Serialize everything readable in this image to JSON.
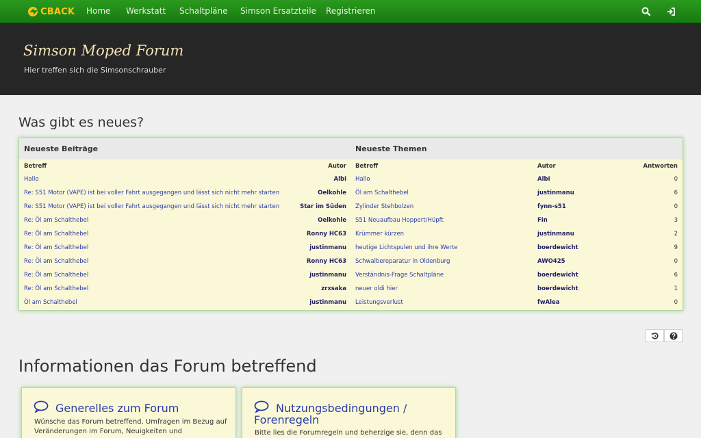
{
  "nav": {
    "brand": "CBACK",
    "items": [
      "Home",
      "Werkstatt",
      "Schaltpläne",
      "Simson Ersatzteile",
      "Registrieren"
    ]
  },
  "header": {
    "title": "Simson Moped Forum",
    "subtitle": "Hier treffen sich die Simsonschrauber"
  },
  "news": {
    "heading": "Was gibt es neues?",
    "posts": {
      "title": "Neueste Beiträge",
      "col_subject": "Betreff",
      "col_author": "Autor",
      "rows": [
        {
          "subject": "Hallo",
          "author": "Albi"
        },
        {
          "subject": "Re: S51 Motor (VAPE) ist bei voller Fahrt ausgegangen und lässt sich nicht mehr starten",
          "author": "Oelkohle"
        },
        {
          "subject": "Re: S51 Motor (VAPE) ist bei voller Fahrt ausgegangen und lässt sich nicht mehr starten",
          "author": "Star im Süden"
        },
        {
          "subject": "Re: Öl am Schalthebel",
          "author": "Oelkohle"
        },
        {
          "subject": "Re: Öl am Schalthebel",
          "author": "Ronny HC63"
        },
        {
          "subject": "Re: Öl am Schalthebel",
          "author": "justinmanu"
        },
        {
          "subject": "Re: Öl am Schalthebel",
          "author": "Ronny HC63"
        },
        {
          "subject": "Re: Öl am Schalthebel",
          "author": "justinmanu"
        },
        {
          "subject": "Re: Öl am Schalthebel",
          "author": "zrxsaka"
        },
        {
          "subject": "Öl am Schalthebel",
          "author": "justinmanu"
        }
      ]
    },
    "topics": {
      "title": "Neueste Themen",
      "col_subject": "Betreff",
      "col_author": "Autor",
      "col_replies": "Antworten",
      "rows": [
        {
          "subject": "Hallo",
          "author": "Albi",
          "replies": "0"
        },
        {
          "subject": "Öl am Schalthebel",
          "author": "justinmanu",
          "replies": "6"
        },
        {
          "subject": "Zylinder Stehbolzen",
          "author": "fynn-s51",
          "replies": "0"
        },
        {
          "subject": "S51 Neuaufbau Hoppert/Hüpft",
          "author": "Fin",
          "replies": "3"
        },
        {
          "subject": "Krümmer kürzen",
          "author": "justinmanu",
          "replies": "2"
        },
        {
          "subject": "heutige Lichtspulen und ihre Werte",
          "author": "boerdewicht",
          "replies": "9"
        },
        {
          "subject": "Schwalbereparatur in Oldenburg",
          "author": "AWO425",
          "replies": "0"
        },
        {
          "subject": "Verständnis-Frage Schaltpläne",
          "author": "boerdewicht",
          "replies": "6"
        },
        {
          "subject": "neuer oldi hier",
          "author": "boerdewicht",
          "replies": "1"
        },
        {
          "subject": "Leistungsverlust",
          "author": "fwAlea",
          "replies": "0"
        }
      ]
    }
  },
  "info": {
    "heading": "Informationen das Forum betreffend",
    "cards": [
      {
        "title": "Generelles zum Forum",
        "desc_1": "Wünsche das Forum betreffend, Umfragen im Bezug auf",
        "desc_2": "Veränderungen im Forum, Neuigkeiten und"
      },
      {
        "title_1": "Nutzungsbedingungen /",
        "title_2": "Forenregeln",
        "desc_1": "Bitte lies die Forumregeln und beherzige sie, denn das"
      }
    ]
  },
  "colors": {
    "nav_green": "#1f8a16",
    "brand_yellow": "#f5c518",
    "header_dark": "#262626",
    "panel_yellow": "#fbf8d8",
    "link_blue": "#2a3ca8"
  },
  "icons": [
    "brand-logo-icon",
    "search-icon",
    "login-icon",
    "refresh-icon",
    "help-icon",
    "speech-bubble-icon"
  ]
}
